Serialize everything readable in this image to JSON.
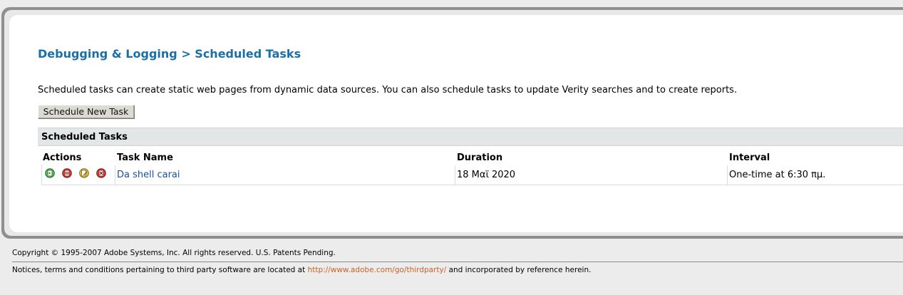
{
  "breadcrumb": {
    "parent": "Debugging & Logging",
    "separator": ">",
    "current": "Scheduled Tasks"
  },
  "description": "Scheduled tasks can create static web pages from dynamic data sources. You can also schedule tasks to update Verity searches and to create reports.",
  "schedule_button": "Schedule New Task",
  "section_title": "Scheduled Tasks",
  "table": {
    "headers": [
      "Actions",
      "Task Name",
      "Duration",
      "Interval"
    ],
    "rows": [
      {
        "action_icons": [
          "run-task-icon",
          "pause-task-icon",
          "edit-task-icon",
          "delete-task-icon"
        ],
        "task_name": "Da shell carai",
        "duration": "18 Μαϊ 2020",
        "interval": "One-time at 6:30 πμ."
      }
    ]
  },
  "footer": {
    "copyright": "Copyright © 1995-2007 Adobe Systems, Inc. All rights reserved. U.S. Patents Pending.",
    "notice_prefix": "Notices, terms and conditions pertaining to third party software are located at",
    "notice_link": "http://www.adobe.com/go/thirdparty/",
    "notice_suffix": "and incorporated by reference herein."
  },
  "colors": {
    "breadcrumb": "#1a6fa6",
    "task_link": "#1a4f9c",
    "footer_link": "#c8622a",
    "section_header_bg": "#e3e6e7"
  }
}
